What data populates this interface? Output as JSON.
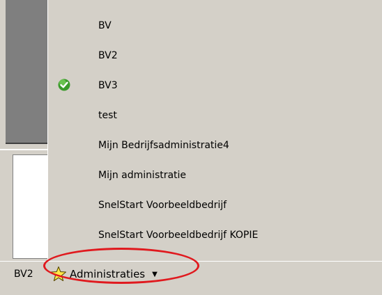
{
  "status_bar": {
    "current_admin": "BV2",
    "admin_button_label": "Administraties"
  },
  "menu": {
    "items": [
      {
        "label": "BV",
        "checked": false
      },
      {
        "label": "BV2",
        "checked": false
      },
      {
        "label": "BV3",
        "checked": true
      },
      {
        "label": "test",
        "checked": false
      },
      {
        "label": "Mijn Bedrijfsadministratie4",
        "checked": false
      },
      {
        "label": "Mijn administratie",
        "checked": false
      },
      {
        "label": "SnelStart Voorbeeldbedrijf",
        "checked": false
      },
      {
        "label": "SnelStart Voorbeeldbedrijf KOPIE",
        "checked": false
      }
    ]
  },
  "colors": {
    "highlight_ellipse": "#e0191e",
    "check_green": "#3a9a2a"
  }
}
